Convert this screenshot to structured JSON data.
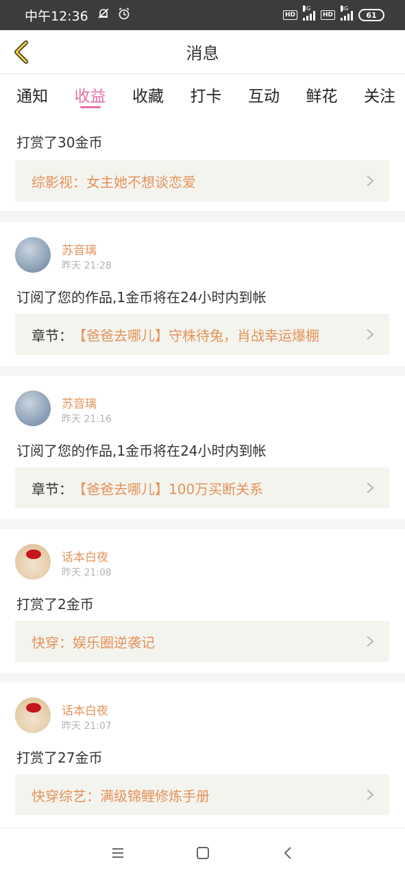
{
  "status_bar": {
    "time": "中午12:36",
    "hd1": "HD",
    "net1": "4G",
    "hd2": "HD",
    "net2": "4G",
    "battery": "61"
  },
  "header": {
    "title": "消息"
  },
  "tabs": [
    {
      "label": "通知"
    },
    {
      "label": "收益",
      "active": true
    },
    {
      "label": "收藏"
    },
    {
      "label": "打卡"
    },
    {
      "label": "互动"
    },
    {
      "label": "鲜花"
    },
    {
      "label": "关注"
    }
  ],
  "feed": [
    {
      "message": "打赏了30金币",
      "link_prefix": "",
      "link_text": "综影视：女主她不想谈恋爱"
    },
    {
      "username": "苏音璃",
      "time": "昨天 21:28",
      "message": "订阅了您的作品,1金币将在24小时内到帐",
      "link_prefix": "章节：",
      "link_text": "【爸爸去哪儿】守株待兔，肖战幸运爆棚"
    },
    {
      "username": "苏音璃",
      "time": "昨天 21:16",
      "message": "订阅了您的作品,1金币将在24小时内到帐",
      "link_prefix": "章节：",
      "link_text": "【爸爸去哪儿】100万买断关系"
    },
    {
      "username": "话本白夜",
      "time": "昨天 21:08",
      "message": "打赏了2金币",
      "link_prefix": "",
      "link_text": "快穿：娱乐圈逆袭记"
    },
    {
      "username": "话本白夜",
      "time": "昨天 21:07",
      "message": "打赏了27金币",
      "link_prefix": "",
      "link_text": "快穿综艺：满级锦鲤修炼手册"
    }
  ],
  "colors": {
    "accent_pink": "#e36fa5",
    "username_orange": "#e3925a",
    "link_bg": "#f4f4ee"
  }
}
